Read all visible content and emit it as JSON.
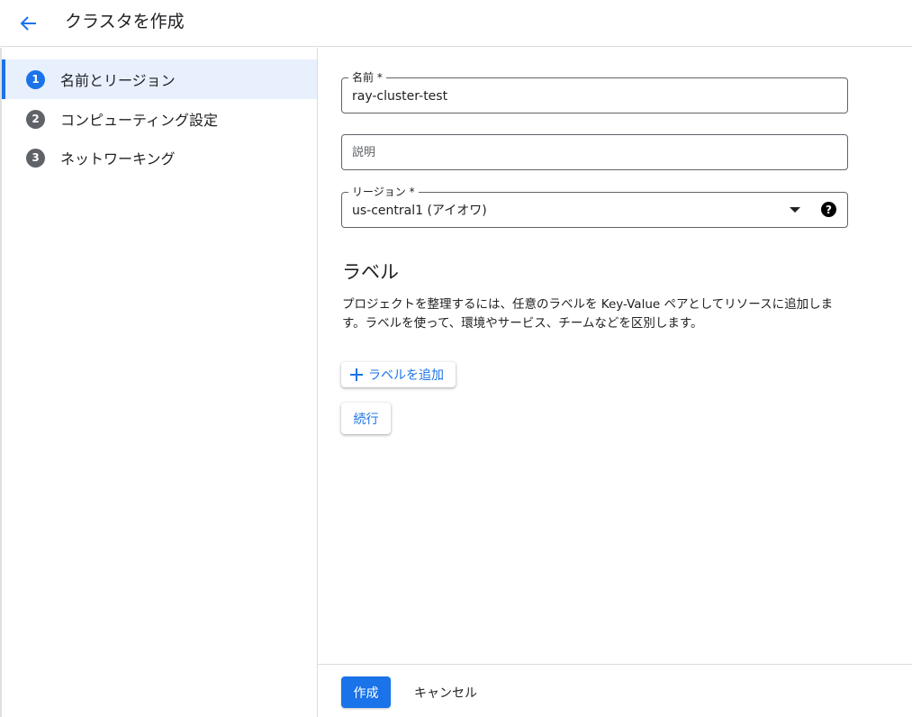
{
  "header": {
    "title": "クラスタを作成",
    "back_icon": "arrow-back-icon"
  },
  "sidebar": {
    "steps": [
      {
        "number": "1",
        "label": "名前とリージョン",
        "active": true
      },
      {
        "number": "2",
        "label": "コンピューティング設定",
        "active": false
      },
      {
        "number": "3",
        "label": "ネットワーキング",
        "active": false
      }
    ]
  },
  "form": {
    "name": {
      "label": "名前 *",
      "value": "ray-cluster-test"
    },
    "description": {
      "placeholder": "説明",
      "value": ""
    },
    "region": {
      "label": "リージョン *",
      "value": "us-central1 (アイオワ)",
      "help_icon": "help-circle-icon"
    }
  },
  "labels_section": {
    "title": "ラベル",
    "description": "プロジェクトを整理するには、任意のラベルを Key-Value ペアとしてリソースに追加します。ラベルを使って、環境やサービス、チームなどを区別します。",
    "add_button": "ラベルを追加"
  },
  "continue_button": "続行",
  "footer": {
    "create_button": "作成",
    "cancel_button": "キャンセル"
  },
  "colors": {
    "accent": "#1a73e8",
    "active_step_bg": "#e8f0fe",
    "inactive_step": "#5f6368",
    "divider": "#dadce0"
  }
}
